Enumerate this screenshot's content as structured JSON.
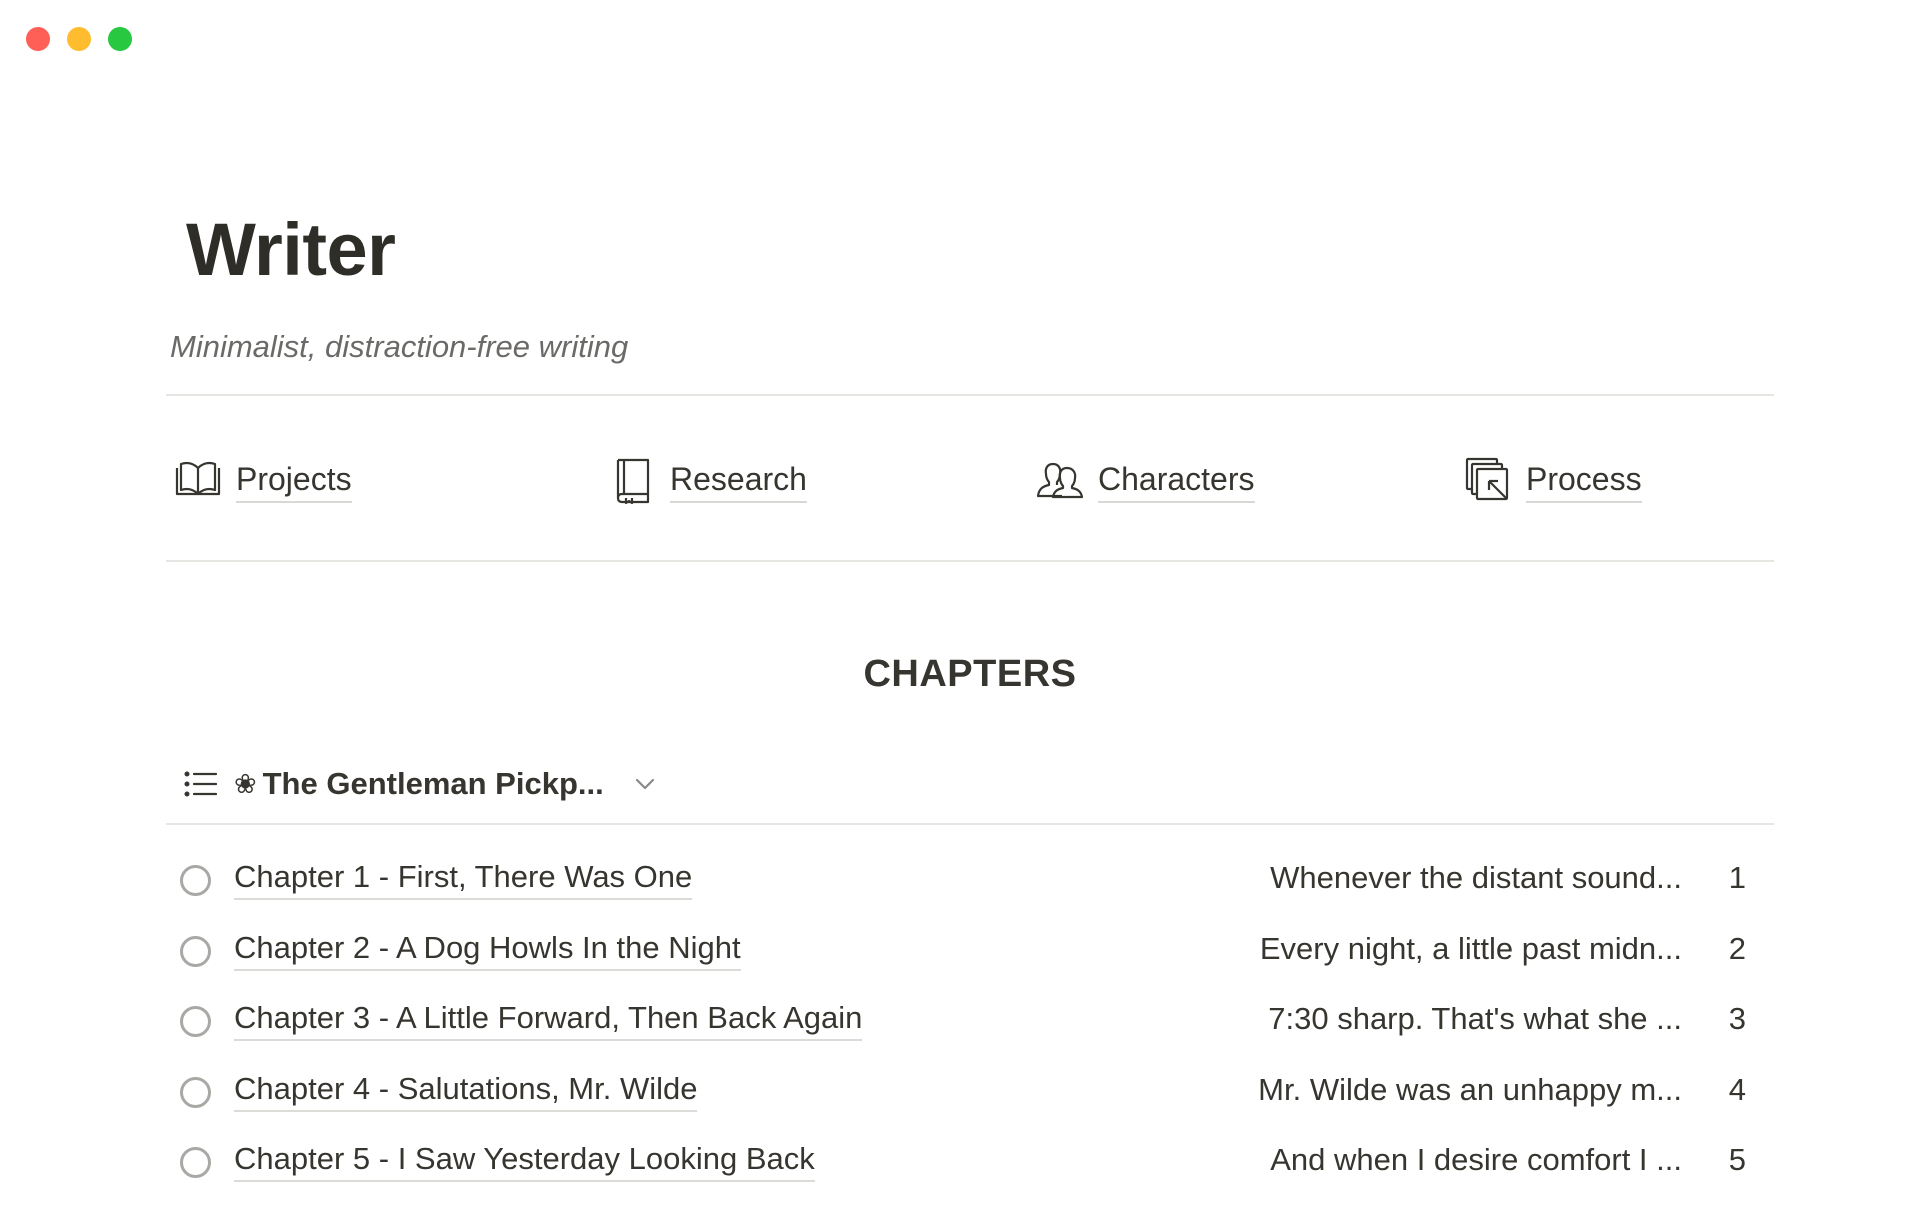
{
  "window": {
    "controls": [
      "close",
      "minimize",
      "maximize"
    ]
  },
  "page": {
    "title": "Writer",
    "subtitle": "Minimalist, distraction-free writing"
  },
  "nav": {
    "items": [
      {
        "label": "Projects",
        "icon": "open-book-icon"
      },
      {
        "label": "Research",
        "icon": "notebook-icon"
      },
      {
        "label": "Characters",
        "icon": "people-icon"
      },
      {
        "label": "Process",
        "icon": "layers-cursor-icon"
      }
    ]
  },
  "chapters": {
    "heading": "CHAPTERS",
    "view": {
      "icon": "list-icon",
      "emoji": "❀",
      "name": "The Gentleman Pickp...",
      "dropdown_icon": "chevron-down-icon"
    },
    "rows": [
      {
        "title": "Chapter 1 - First, There Was One",
        "excerpt": "Whenever the distant sound...",
        "number": "1"
      },
      {
        "title": "Chapter 2 - A Dog Howls In the Night",
        "excerpt": "Every night, a little past midn...",
        "number": "2"
      },
      {
        "title": "Chapter 3 - A Little Forward, Then Back Again",
        "excerpt": "7:30 sharp. That's what she ...",
        "number": "3"
      },
      {
        "title": "Chapter 4 - Salutations, Mr. Wilde",
        "excerpt": "Mr. Wilde was an unhappy m...",
        "number": "4"
      },
      {
        "title": "Chapter 5 - I Saw Yesterday Looking Back",
        "excerpt": "And when I desire comfort I ...",
        "number": "5"
      }
    ]
  },
  "colors": {
    "text": "#37352f",
    "muted": "#6b6a67",
    "divider": "#e6e5e2",
    "close": "#fe5f57",
    "minimize": "#febc2e",
    "maximize": "#28c840"
  }
}
